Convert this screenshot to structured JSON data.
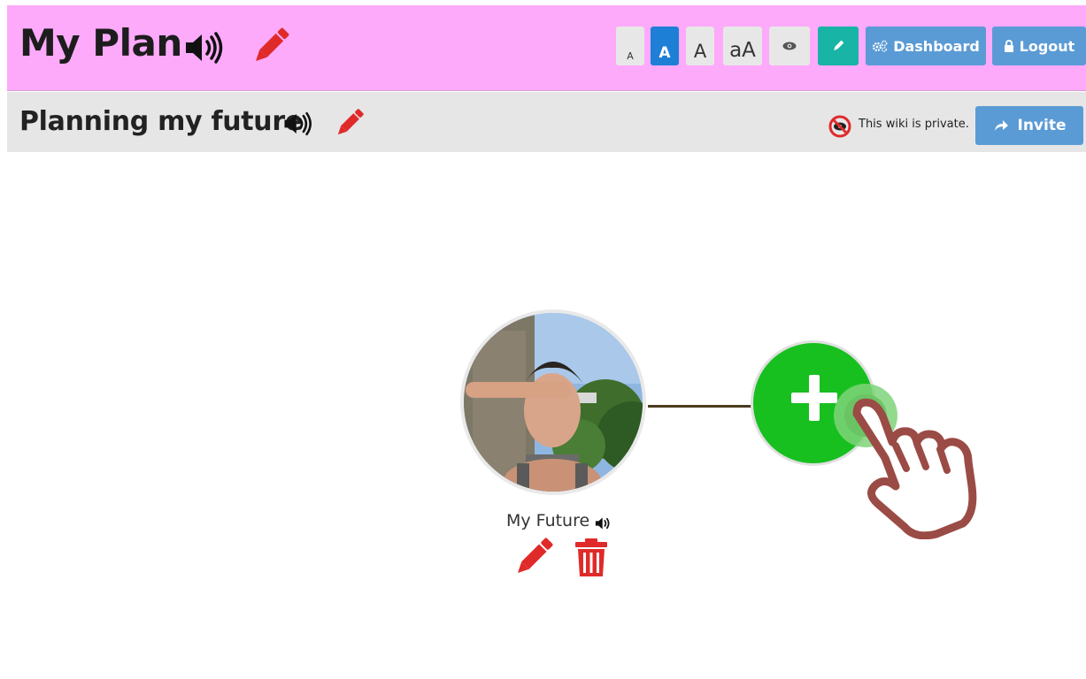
{
  "header": {
    "title": "My Plan",
    "font_buttons": [
      "A",
      "A",
      "A",
      "aA"
    ],
    "dashboard_label": "Dashboard",
    "logout_label": "Logout"
  },
  "subheader": {
    "title": "Planning my future",
    "privacy_text": "This wiki is private.",
    "invite_label": "Invite"
  },
  "map": {
    "node_label": "My Future"
  },
  "colors": {
    "header_bg": "#fdaafb",
    "subheader_bg": "#e6e6e6",
    "accent_blue": "#5b9bd5",
    "selected_blue": "#1e7fd6",
    "teal": "#18b4a6",
    "red_icon": "#e02a2a",
    "add_green": "#17c01f",
    "hand_outline": "#9b4b45"
  },
  "icons": [
    "speaker-icon",
    "pencil-icon",
    "eye-icon",
    "gears-icon",
    "lock-icon",
    "private-eye-icon",
    "share-arrow-icon",
    "trash-icon",
    "plus-icon",
    "pointing-hand-icon"
  ]
}
